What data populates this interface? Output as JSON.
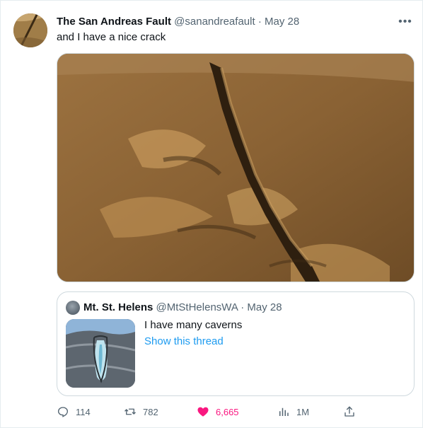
{
  "tweet": {
    "display_name": "The San Andreas Fault",
    "handle": "@sanandreafault",
    "separator": "·",
    "date": "May 28",
    "text": "and I have a nice crack",
    "more_label": "•••"
  },
  "quote": {
    "display_name": "Mt. St. Helens",
    "handle": "@MtStHelensWA",
    "separator": "·",
    "date": "May 28",
    "text": "I have many caverns",
    "show_thread": "Show this thread"
  },
  "actions": {
    "replies": "114",
    "retweets": "782",
    "likes": "6,665",
    "views": "1M"
  },
  "colors": {
    "accent": "#1d9bf0",
    "like": "#f91880",
    "muted": "#536471"
  },
  "icons": [
    "reply-icon",
    "retweet-icon",
    "heart-icon",
    "analytics-icon",
    "share-icon",
    "more-icon"
  ]
}
